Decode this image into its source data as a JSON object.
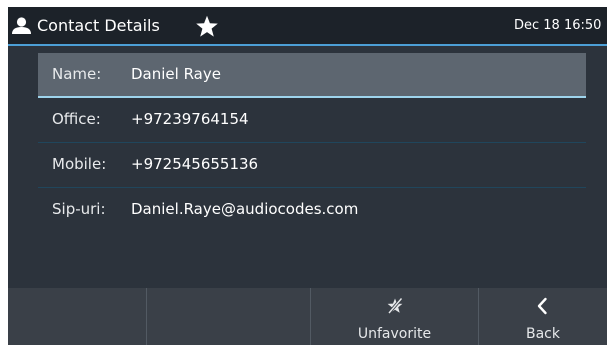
{
  "header": {
    "title": "Contact Details",
    "datetime": "Dec 18 16:50"
  },
  "contact": {
    "fields": [
      {
        "label": "Name:",
        "value": "Daniel Raye"
      },
      {
        "label": "Office:",
        "value": "+97239764154"
      },
      {
        "label": "Mobile:",
        "value": "+972545655136"
      },
      {
        "label": "Sip-uri:",
        "value": "Daniel.Raye@audiocodes.com"
      }
    ]
  },
  "softkeys": {
    "unfavorite_label": "Unfavorite",
    "back_label": "Back"
  },
  "icons": {
    "header_left": "user-icon",
    "header_favorite": "star-icon",
    "unfavorite": "star-slash-icon",
    "back": "chevron-left-icon"
  },
  "colors": {
    "background": "#2c333c",
    "statusbar": "#1c2229",
    "accent": "#4c9fd6",
    "selected_row": "#5d6670",
    "softkey_bar": "#3a4048"
  }
}
